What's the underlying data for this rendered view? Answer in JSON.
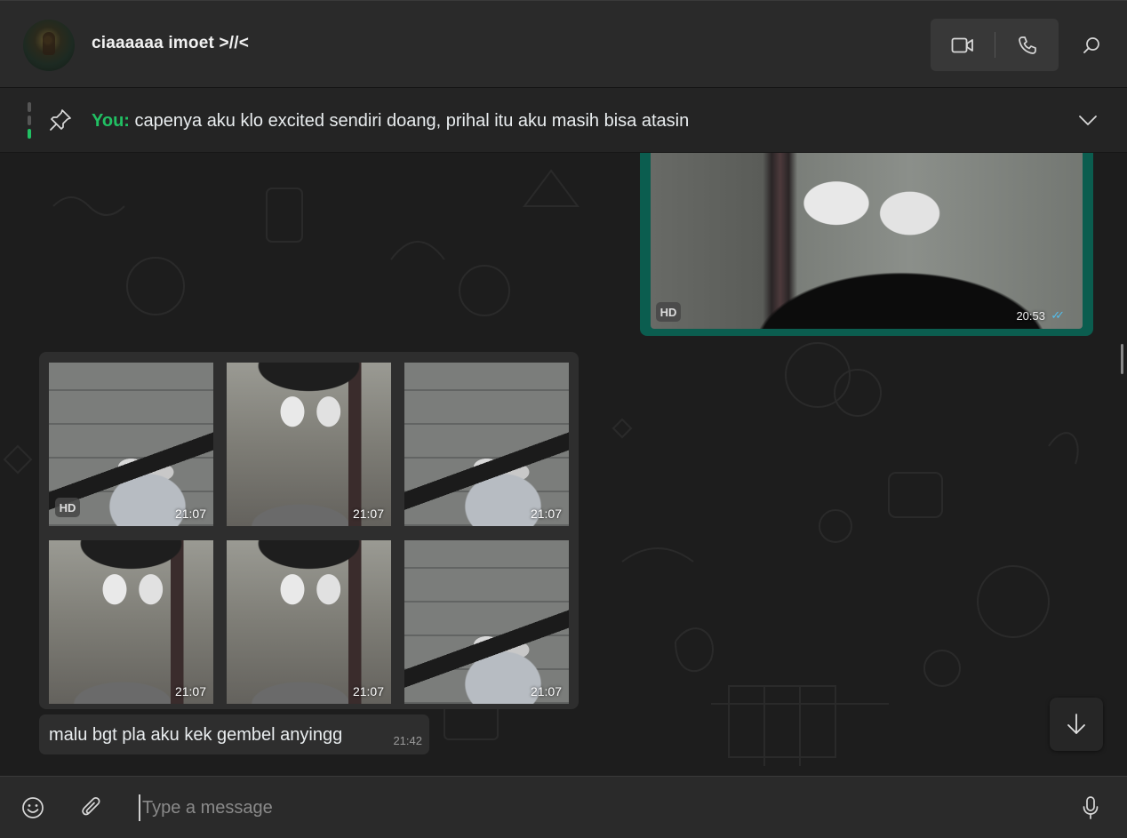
{
  "header": {
    "contact_name": "ciaaaaaa imoet >//<",
    "icons": {
      "video": "video-call-icon",
      "voice": "voice-call-icon",
      "search": "search-icon"
    }
  },
  "pinned": {
    "sender": "You:",
    "text": "capenya aku klo excited sendiri doang, prihal itu aku masih bisa atasin",
    "icons": {
      "pin": "pin-icon",
      "expand": "chevron-down-icon"
    }
  },
  "messages": {
    "outgoing_image": {
      "badge": "HD",
      "time": "20:53",
      "status": "read"
    },
    "image_grid": [
      {
        "time": "21:07",
        "badge": "HD"
      },
      {
        "time": "21:07"
      },
      {
        "time": "21:07"
      },
      {
        "time": "21:07"
      },
      {
        "time": "21:07"
      },
      {
        "time": "21:07"
      }
    ],
    "text_message": {
      "text": "malu bgt pla aku kek gembel anyingg",
      "time": "21:42"
    }
  },
  "composer": {
    "placeholder": "Type a message",
    "icons": {
      "emoji": "emoji-icon",
      "attach": "paperclip-icon",
      "mic": "microphone-icon"
    }
  },
  "colors": {
    "accent": "#21c063",
    "outgoing_bubble": "#0b5d4f",
    "read_ticks": "#53bdeb"
  }
}
